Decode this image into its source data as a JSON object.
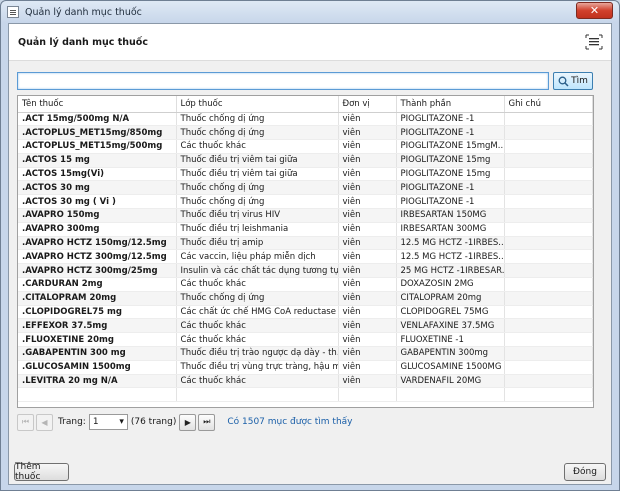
{
  "window": {
    "title": "Quản lý danh mục thuốc",
    "close_glyph": "✕"
  },
  "header": {
    "title": "Quản lý danh mục thuốc",
    "menu_icon": "list-menu-icon"
  },
  "search": {
    "value": "",
    "placeholder": "",
    "button_label": "Tìm"
  },
  "table": {
    "columns": [
      "Tên thuốc",
      "Lớp thuốc",
      "Đơn vị",
      "Thành phần",
      "Ghi chú"
    ],
    "rows": [
      [
        ".ACT 15mg/500mg N/A",
        "Thuốc chống dị ứng",
        "viên",
        "PIOGLITAZONE -1",
        ""
      ],
      [
        ".ACTOPLUS_MET15mg/850mg",
        "Thuốc chống dị ứng",
        "viên",
        "PIOGLITAZONE -1",
        ""
      ],
      [
        ".ACTOPLUS_MET15mg/500mg",
        "Các thuốc khác",
        "viên",
        "PIOGLITAZONE 15mgM...",
        ""
      ],
      [
        ".ACTOS 15 mg",
        "Thuốc điều trị viêm tai giữa",
        "viên",
        "PIOGLITAZONE 15mg",
        ""
      ],
      [
        ".ACTOS 15mg(Vi)",
        "Thuốc điều trị viêm tai giữa",
        "viên",
        "PIOGLITAZONE 15mg",
        ""
      ],
      [
        ".ACTOS 30 mg",
        "Thuốc chống dị ứng",
        "viên",
        "PIOGLITAZONE -1",
        ""
      ],
      [
        ".ACTOS 30 mg ( Vi )",
        "Thuốc chống dị ứng",
        "viên",
        "PIOGLITAZONE -1",
        ""
      ],
      [
        ".AVAPRO 150mg",
        "Thuốc điều trị virus HIV",
        "viên",
        "IRBESARTAN 150MG",
        ""
      ],
      [
        ".AVAPRO 300mg",
        "Thuốc điều trị leishmania",
        "viên",
        "IRBESARTAN 300MG",
        ""
      ],
      [
        ".AVAPRO HCTZ  150mg/12.5mg",
        "Thuốc điều trị amip",
        "viên",
        "12.5 MG HCTZ -1IRBES...",
        ""
      ],
      [
        ".AVAPRO HCTZ 300mg/12.5mg",
        "Các vaccin, liệu pháp miễn dịch",
        "viên",
        "12.5 MG HCTZ -1IRBES...",
        ""
      ],
      [
        ".AVAPRO HCTZ 300mg/25mg",
        "Insulin và các chất tác dụng tương tự",
        "viên",
        "25 MG HCTZ -1IRBESAR...",
        ""
      ],
      [
        ".CARDURAN 2mg",
        "Các thuốc khác",
        "viên",
        "DOXAZOSIN 2MG",
        ""
      ],
      [
        ".CITALOPRAM 20mg",
        "Thuốc chống dị ứng",
        "viên",
        "CITALOPRAM 20mg",
        ""
      ],
      [
        ".CLOPIDOGREL75 mg",
        "Các chất ức chế HMG CoA reductase",
        "viên",
        "CLOPIDOGREL 75MG",
        ""
      ],
      [
        ".EFFEXOR 37.5mg",
        "Các thuốc khác",
        "viên",
        "VENLAFAXINE 37.5MG",
        ""
      ],
      [
        ".FLUOXETINE 20mg",
        "Các thuốc khác",
        "viên",
        "FLUOXETINE -1",
        ""
      ],
      [
        ".GABAPENTIN 300 mg",
        "Thuốc điều trị trào ngược dạ dày - th...",
        "viên",
        "GABAPENTIN 300mg",
        ""
      ],
      [
        ".GLUCOSAMIN 1500mg",
        "Thuốc điều trị vùng trực tràng, hậu m...",
        "viên",
        "GLUCOSAMINE 1500MG",
        ""
      ],
      [
        ".LEVITRA 20 mg N/A",
        "Các thuốc khác",
        "viên",
        "VARDENAFIL 20MG",
        ""
      ],
      [
        "",
        "",
        "",
        "",
        ""
      ]
    ]
  },
  "pager": {
    "first_glyph": "⏮",
    "prev_glyph": "◀",
    "next_glyph": "▶",
    "last_glyph": "⏭",
    "page_label": "Trang:",
    "current_page": "1",
    "total_pages": "(76 trang)",
    "found_text": "Có 1507 mục được tìm thấy"
  },
  "footer": {
    "add_label": "Thêm thuốc",
    "close_label": "Đóng"
  }
}
